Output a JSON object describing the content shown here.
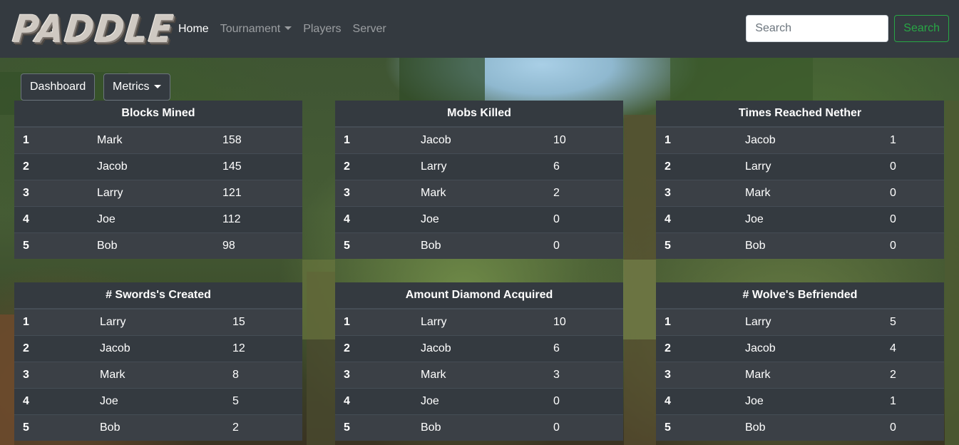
{
  "brand": {
    "logo_text": "PADDLE"
  },
  "nav": {
    "home": "Home",
    "tournament": "Tournament",
    "players": "Players",
    "server": "Server"
  },
  "search": {
    "placeholder": "Search",
    "button": "Search"
  },
  "toolbar": {
    "dashboard": "Dashboard",
    "metrics": "Metrics"
  },
  "tables": [
    {
      "title": "Blocks Mined",
      "rows": [
        [
          "1",
          "Mark",
          "158"
        ],
        [
          "2",
          "Jacob",
          "145"
        ],
        [
          "3",
          "Larry",
          "121"
        ],
        [
          "4",
          "Joe",
          "112"
        ],
        [
          "5",
          "Bob",
          "98"
        ]
      ]
    },
    {
      "title": "Mobs Killed",
      "rows": [
        [
          "1",
          "Jacob",
          "10"
        ],
        [
          "2",
          "Larry",
          "6"
        ],
        [
          "3",
          "Mark",
          "2"
        ],
        [
          "4",
          "Joe",
          "0"
        ],
        [
          "5",
          "Bob",
          "0"
        ]
      ]
    },
    {
      "title": "Times Reached Nether",
      "rows": [
        [
          "1",
          "Jacob",
          "1"
        ],
        [
          "2",
          "Larry",
          "0"
        ],
        [
          "3",
          "Mark",
          "0"
        ],
        [
          "4",
          "Joe",
          "0"
        ],
        [
          "5",
          "Bob",
          "0"
        ]
      ]
    },
    {
      "title": "# Swords's Created",
      "rows": [
        [
          "1",
          "Larry",
          "15"
        ],
        [
          "2",
          "Jacob",
          "12"
        ],
        [
          "3",
          "Mark",
          "8"
        ],
        [
          "4",
          "Joe",
          "5"
        ],
        [
          "5",
          "Bob",
          "2"
        ]
      ]
    },
    {
      "title": "Amount Diamond Acquired",
      "rows": [
        [
          "1",
          "Larry",
          "10"
        ],
        [
          "2",
          "Jacob",
          "6"
        ],
        [
          "3",
          "Mark",
          "3"
        ],
        [
          "4",
          "Joe",
          "0"
        ],
        [
          "5",
          "Bob",
          "0"
        ]
      ]
    },
    {
      "title": "# Wolve's Befriended",
      "rows": [
        [
          "1",
          "Larry",
          "5"
        ],
        [
          "2",
          "Jacob",
          "4"
        ],
        [
          "3",
          "Mark",
          "2"
        ],
        [
          "4",
          "Joe",
          "1"
        ],
        [
          "5",
          "Bob",
          "0"
        ]
      ]
    }
  ]
}
